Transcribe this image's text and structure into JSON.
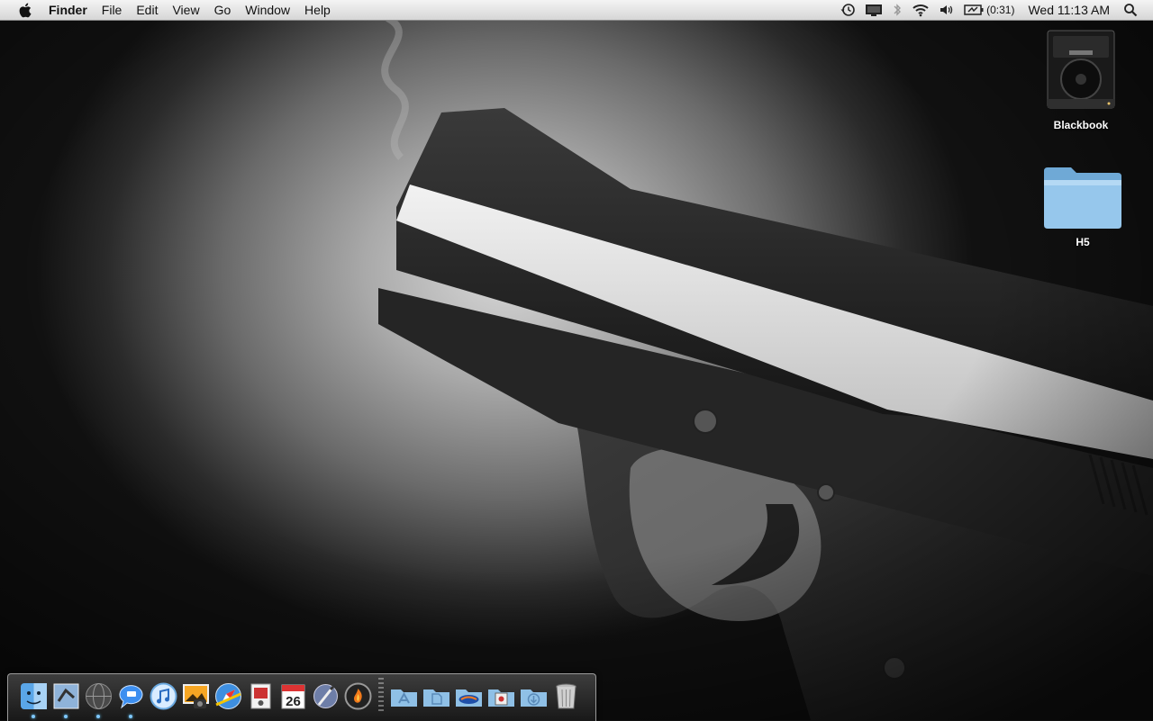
{
  "menubar": {
    "app_name": "Finder",
    "menus": [
      "File",
      "Edit",
      "View",
      "Go",
      "Window",
      "Help"
    ],
    "battery_time": "(0:31)",
    "clock": "Wed 11:13 AM",
    "status_icons": [
      "time-machine-icon",
      "display-icon",
      "bluetooth-icon",
      "wifi-icon",
      "volume-icon",
      "battery-icon",
      "spotlight-icon"
    ]
  },
  "desktop": {
    "icons": [
      {
        "label": "Blackbook",
        "icon": "hard-drive-icon"
      },
      {
        "label": "H5",
        "icon": "folder-icon"
      }
    ]
  },
  "dock": {
    "apps": [
      {
        "name": "finder",
        "running": true
      },
      {
        "name": "mail",
        "running": true
      },
      {
        "name": "network",
        "running": true
      },
      {
        "name": "ichat",
        "running": true
      },
      {
        "name": "itunes",
        "running": false
      },
      {
        "name": "iphoto",
        "running": false
      },
      {
        "name": "safari",
        "running": false
      },
      {
        "name": "preview",
        "running": false
      },
      {
        "name": "ical",
        "running": false
      },
      {
        "name": "script-editor",
        "running": false
      },
      {
        "name": "burn",
        "running": false
      }
    ],
    "calendar_day": "26",
    "stacks": [
      "applications-stack",
      "documents-stack",
      "gators-folder-stack",
      "utilities-stack",
      "downloads-stack",
      "trash"
    ]
  },
  "colors": {
    "menubar_top": "#f4f4f4",
    "menubar_bottom": "#d6d6d6",
    "folder_blue": "#8fc0e6",
    "dock_indicator": "#7fc7ff"
  }
}
